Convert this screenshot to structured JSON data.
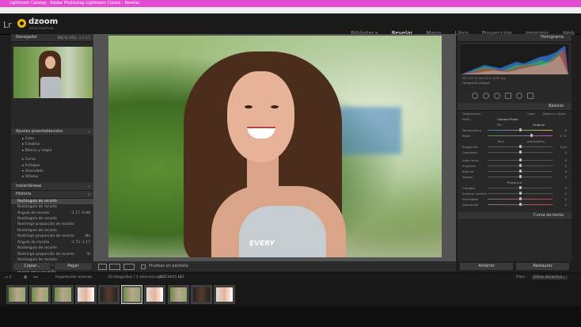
{
  "window": {
    "title": "Lightroom Catalog - Adobe Photoshop Lightroom Classic - Revelar"
  },
  "menu": [
    "Archivo",
    "Editar",
    "Revelar",
    "Fotografía",
    "Ajustes",
    "Herramientas",
    "Ver",
    "Ventana",
    "Ayuda"
  ],
  "identity": {
    "logo_text": "Lr",
    "brand": "dzoom",
    "brand_tag": "FOTO POSITIVA"
  },
  "modules": [
    {
      "label": "Biblioteca",
      "active": false
    },
    {
      "label": "Revelar",
      "active": true
    },
    {
      "label": "Mapa",
      "active": false
    },
    {
      "label": "Libro",
      "active": false
    },
    {
      "label": "Proyección",
      "active": false
    },
    {
      "label": "Imprimir",
      "active": false
    },
    {
      "label": "Web",
      "active": false
    }
  ],
  "left_panel": {
    "navigator": {
      "title": "Navegador",
      "zoom_options": "ENCAJ.  RELL.  1:1  2:1"
    },
    "presets": {
      "title": "Ajustes preestablecidos",
      "items": [
        "Color",
        "Creativo",
        "Blanco y negro",
        "Curva",
        "Enfoque",
        "Granulado",
        "Viñetas"
      ]
    },
    "snapshots": {
      "title": "Instantáneas"
    },
    "history": {
      "title": "Historia",
      "items": [
        {
          "label": "Rectángulo de recorte",
          "value": "",
          "selected": true
        },
        {
          "label": "Rectángulo de recorte",
          "value": ""
        },
        {
          "label": "Ángulo de recorte",
          "value": "-1.17  -0.98"
        },
        {
          "label": "Rectángulo de recorte",
          "value": ""
        },
        {
          "label": "Restringir proporción de recorte",
          "value": ""
        },
        {
          "label": "Rectángulo de recorte",
          "value": ""
        },
        {
          "label": "Restringir proporción de recorte",
          "value": "No"
        },
        {
          "label": "Ángulo de recorte",
          "value": "-1.73  -1.17"
        },
        {
          "label": "Rectángulo de recorte",
          "value": ""
        },
        {
          "label": "Restringir proporción de recorte",
          "value": "Sí"
        },
        {
          "label": "Rectángulo de recorte",
          "value": ""
        },
        {
          "label": "Quitar la aberración cromática",
          "value": ""
        },
        {
          "label": "Activar perfil de lente",
          "value": ""
        }
      ]
    },
    "copy_button": "Copiar...",
    "paste_button": "Pegar"
  },
  "toolbar": {
    "softproof_label": "Pruebas en pantalla"
  },
  "photo": {
    "shirt_text": "EVERY"
  },
  "right_panel": {
    "histogram_title": "Histograma",
    "histogram_info": "ISO 200   50 mm   f/2.8   1/250 seg",
    "original_photo_label": "Fotografía original",
    "basic_title": "Básicos",
    "treatment_label": "Tratamiento :",
    "treatment_options": [
      "Color",
      "Blanco y negro"
    ],
    "profile_label": "Perfil :",
    "profile_value": "Cámara Plana",
    "wb_label": "EB :",
    "wb_value": "Original",
    "temp_label": "Temperatura",
    "temp_value": "0",
    "tint_label": "Matiz",
    "tint_value": "+ 21",
    "tone_label": "Tono",
    "auto_label": "Automático",
    "sliders": [
      {
        "label": "Exposición",
        "value": "0,00"
      },
      {
        "label": "Contraste",
        "value": "0"
      },
      {
        "label": "Altas luces",
        "value": "0"
      },
      {
        "label": "Sombras",
        "value": "0"
      },
      {
        "label": "Blancos",
        "value": "0"
      },
      {
        "label": "Negros",
        "value": "0"
      }
    ],
    "presence_label": "Presencia",
    "presence_sliders": [
      {
        "label": "Claridad",
        "value": "0"
      },
      {
        "label": "Eliminar neblina",
        "value": "0"
      },
      {
        "label": "Intensidad",
        "value": "0"
      },
      {
        "label": "Saturación",
        "value": "0"
      }
    ],
    "tone_curve_title": "Curva de tonos",
    "prev_button": "Anterior",
    "reset_button": "Restaurar"
  },
  "filmstrip": {
    "source": "Importación anterior",
    "count": "10 fotografías / 1 seleccionada /",
    "filename": "_DSC8605.NEF",
    "filter_label": "Filtro :",
    "filter_value": "Filtros desactiva..."
  }
}
